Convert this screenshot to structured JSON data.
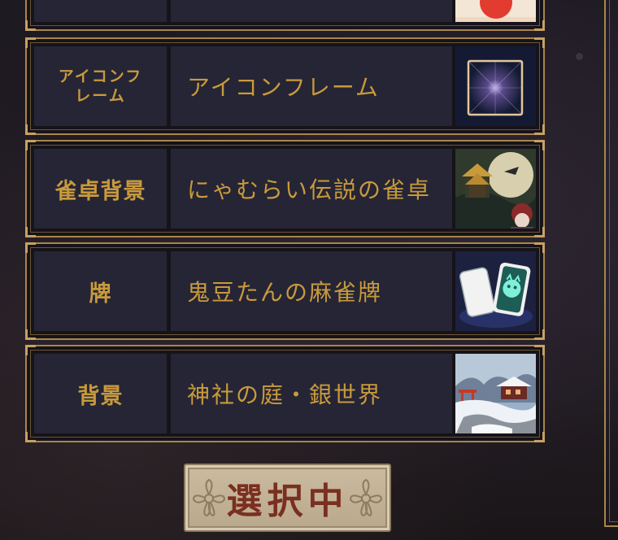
{
  "rows": [
    {
      "category": "",
      "name": "",
      "thumb": "red-sun-icon"
    },
    {
      "category_line1": "アイコンフ",
      "category_line2": "レーム",
      "name": "アイコンフレーム",
      "thumb": "icon-frame-thumbnail"
    },
    {
      "category": "雀卓背景",
      "name": "にゃむらい伝説の雀卓",
      "thumb": "castle-moon-thumbnail"
    },
    {
      "category": "牌",
      "name": "鬼豆たんの麻雀牌",
      "thumb": "mahjong-tiles-thumbnail"
    },
    {
      "category": "背景",
      "name": "神社の庭・銀世界",
      "thumb": "snow-shrine-thumbnail"
    }
  ],
  "select_button": {
    "label": "選択中",
    "icon": "cherry-blossom-icon"
  },
  "colors": {
    "gold_text": "#c99a3c",
    "border_gold": "#a8864c",
    "cell_bg": "#252535",
    "button_text": "#7a2f20"
  }
}
